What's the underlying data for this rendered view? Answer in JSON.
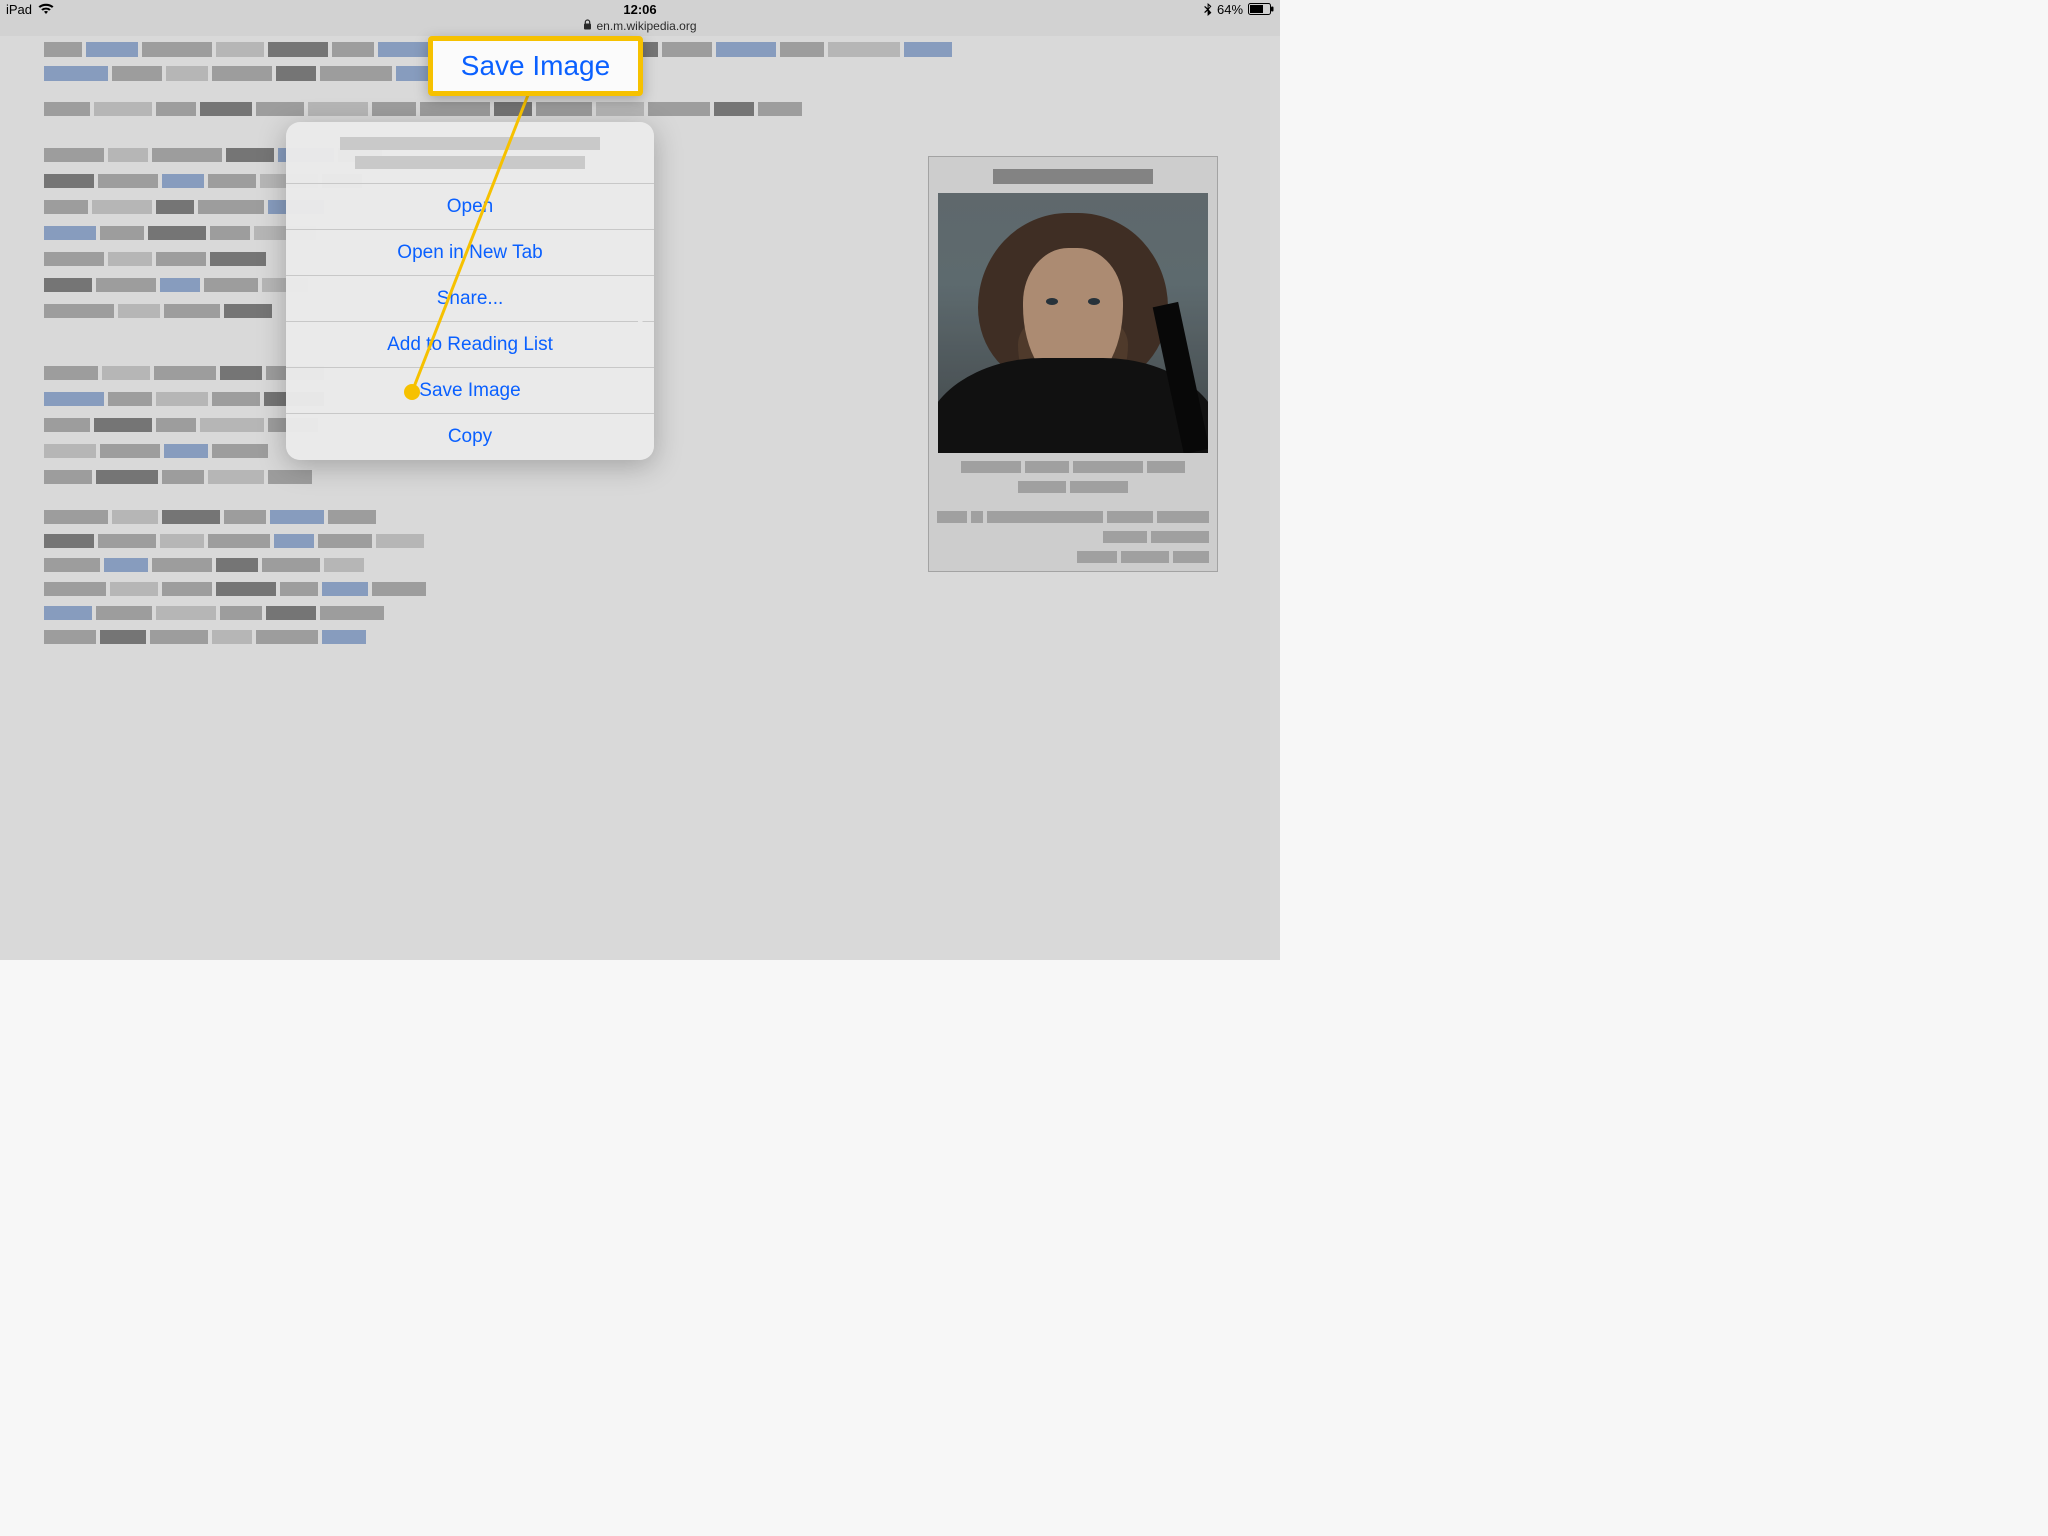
{
  "status_bar": {
    "device": "iPad",
    "time": "12:06",
    "battery_pct": "64%"
  },
  "url_bar": {
    "host": "en.m.wikipedia.org"
  },
  "context_menu": {
    "items": {
      "open": "Open",
      "open_new_tab": "Open in New Tab",
      "share": "Share...",
      "reading_list": "Add to Reading List",
      "save_image": "Save Image",
      "copy": "Copy"
    }
  },
  "callout": {
    "label": "Save Image"
  }
}
